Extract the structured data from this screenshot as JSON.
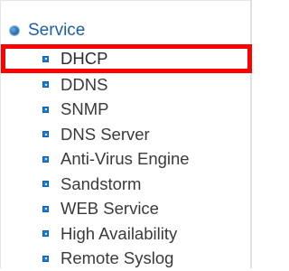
{
  "menu": {
    "section_label": "Service",
    "section_icon": "sphere-icon",
    "items": [
      {
        "label": "DHCP",
        "highlighted": true
      },
      {
        "label": "DDNS"
      },
      {
        "label": "SNMP"
      },
      {
        "label": "DNS Server"
      },
      {
        "label": "Anti-Virus Engine"
      },
      {
        "label": "Sandstorm"
      },
      {
        "label": "WEB Service"
      },
      {
        "label": "High Availability"
      },
      {
        "label": "Remote Syslog"
      }
    ]
  },
  "colors": {
    "section_text": "#1e5ea6",
    "bullet": "#1f7fd6",
    "highlight_border": "#ff0000",
    "item_text": "#3a3a3a"
  }
}
